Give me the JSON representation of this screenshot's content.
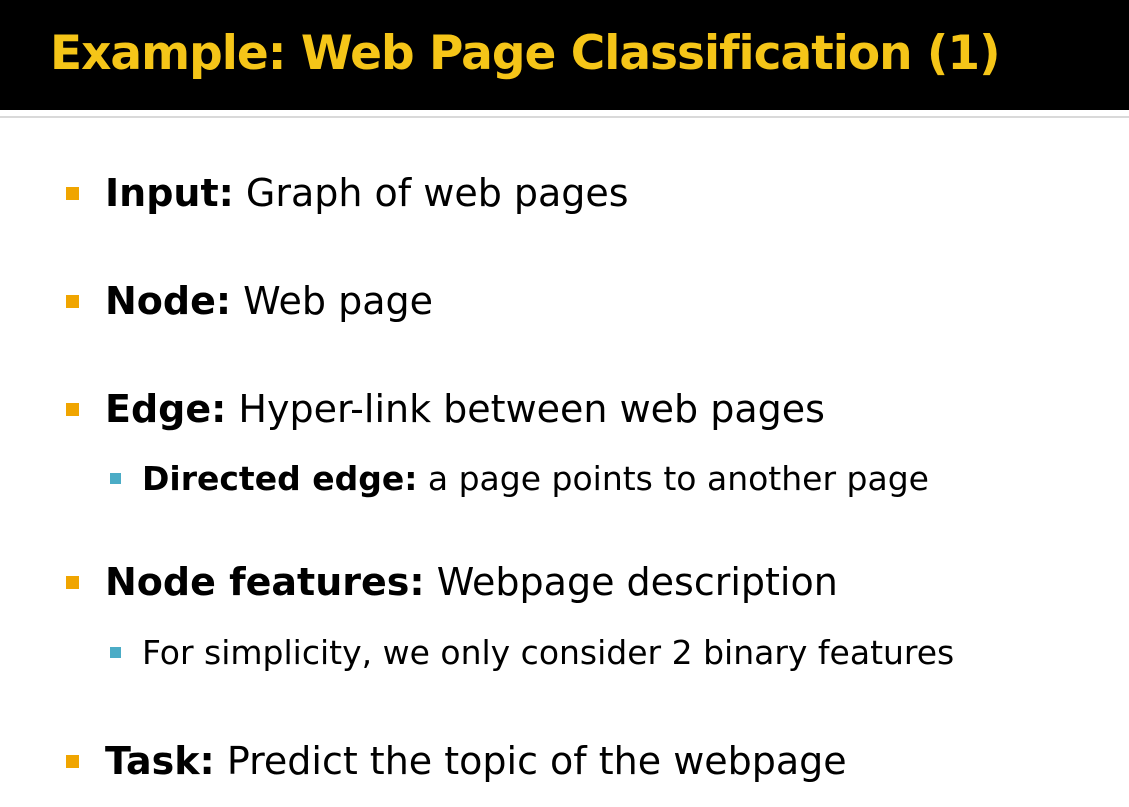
{
  "slide": {
    "title": "Example: Web Page Classification (1)",
    "bullets": [
      {
        "label": "Input:",
        "text": " Graph of web pages"
      },
      {
        "label": "Node:",
        "text": " Web page"
      },
      {
        "label": "Edge:",
        "text": " Hyper-link between web pages",
        "sub": {
          "label": "Directed edge:",
          "text": " a page points to another page"
        }
      },
      {
        "label": "Node features:",
        "text": " Webpage description",
        "sub": {
          "label": "",
          "text": "For simplicity, we only consider 2 binary features"
        }
      },
      {
        "label": "Task:",
        "text": " Predict the topic of the webpage"
      }
    ]
  },
  "colors": {
    "title_background": "#000000",
    "title_text": "#f5c518",
    "level1_bullet": "#f0a500",
    "level2_bullet": "#4bacc6"
  }
}
